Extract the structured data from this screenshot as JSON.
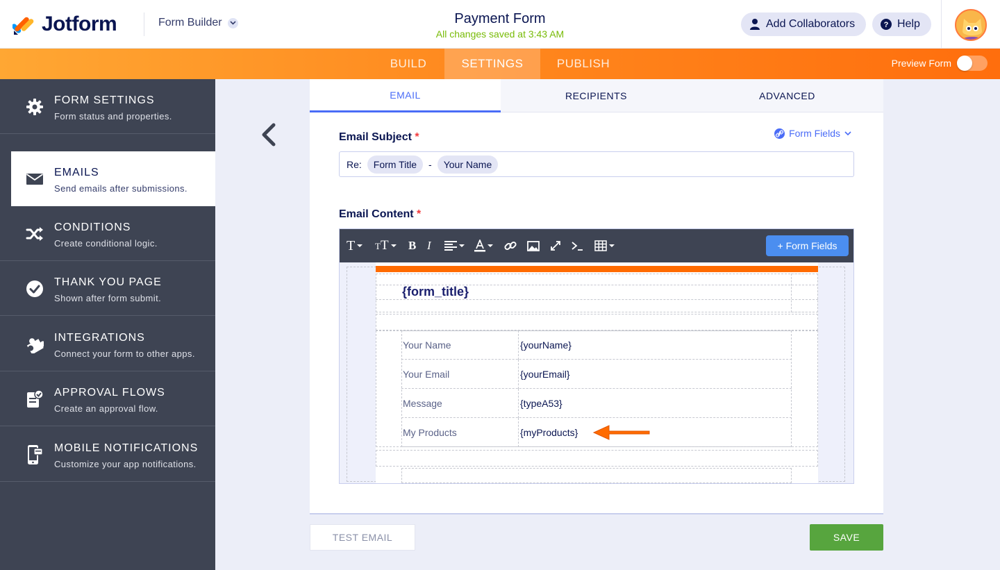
{
  "app": {
    "brand": "Jotform",
    "builder_menu": "Form Builder",
    "form_title": "Payment Form",
    "save_status": "All changes saved at 3:43 AM",
    "collaborators_label": "Add Collaborators",
    "help_label": "Help"
  },
  "nav": {
    "tabs": [
      "BUILD",
      "SETTINGS",
      "PUBLISH"
    ],
    "active_tab": "SETTINGS",
    "preview_label": "Preview Form",
    "preview_on": false
  },
  "sidebar": {
    "items": [
      {
        "title": "FORM SETTINGS",
        "subtitle": "Form status and properties.",
        "icon": "gear-icon"
      },
      {
        "title": "EMAILS",
        "subtitle": "Send emails after submissions.",
        "icon": "envelope-icon"
      },
      {
        "title": "CONDITIONS",
        "subtitle": "Create conditional logic.",
        "icon": "shuffle-icon"
      },
      {
        "title": "THANK YOU PAGE",
        "subtitle": "Shown after form submit.",
        "icon": "check-circle-icon"
      },
      {
        "title": "INTEGRATIONS",
        "subtitle": "Connect your form to other apps.",
        "icon": "puzzle-icon"
      },
      {
        "title": "APPROVAL FLOWS",
        "subtitle": "Create an approval flow.",
        "icon": "approval-doc-icon"
      },
      {
        "title": "MOBILE NOTIFICATIONS",
        "subtitle": "Customize your app notifications.",
        "icon": "mobile-icon"
      }
    ],
    "active_index": 1
  },
  "email_tabs": [
    "EMAIL",
    "RECIPIENTS",
    "ADVANCED"
  ],
  "subject": {
    "label": "Email Subject",
    "required_mark": "*",
    "form_fields_link": "Form Fields",
    "prefix": "Re:",
    "chip1": "Form Title",
    "separator": "-",
    "chip2": "Your Name"
  },
  "content": {
    "label": "Email Content",
    "required_mark": "*",
    "form_fields_button": "+ Form Fields",
    "template_title": "{form_title}",
    "rows": [
      {
        "label": "Your Name",
        "value": "{yourName}"
      },
      {
        "label": "Your Email",
        "value": "{yourEmail}"
      },
      {
        "label": "Message",
        "value": "{typeA53}"
      },
      {
        "label": "My Products",
        "value": "{myProducts}"
      }
    ],
    "accent_color": "#ff6b00"
  },
  "footer": {
    "test_email": "TEST EMAIL",
    "save": "SAVE"
  },
  "colors": {
    "brand_orange": "#ff7a1a",
    "primary_blue": "#4a6cf7",
    "save_green": "#57a53e",
    "sidebar_bg": "#3e4453"
  }
}
